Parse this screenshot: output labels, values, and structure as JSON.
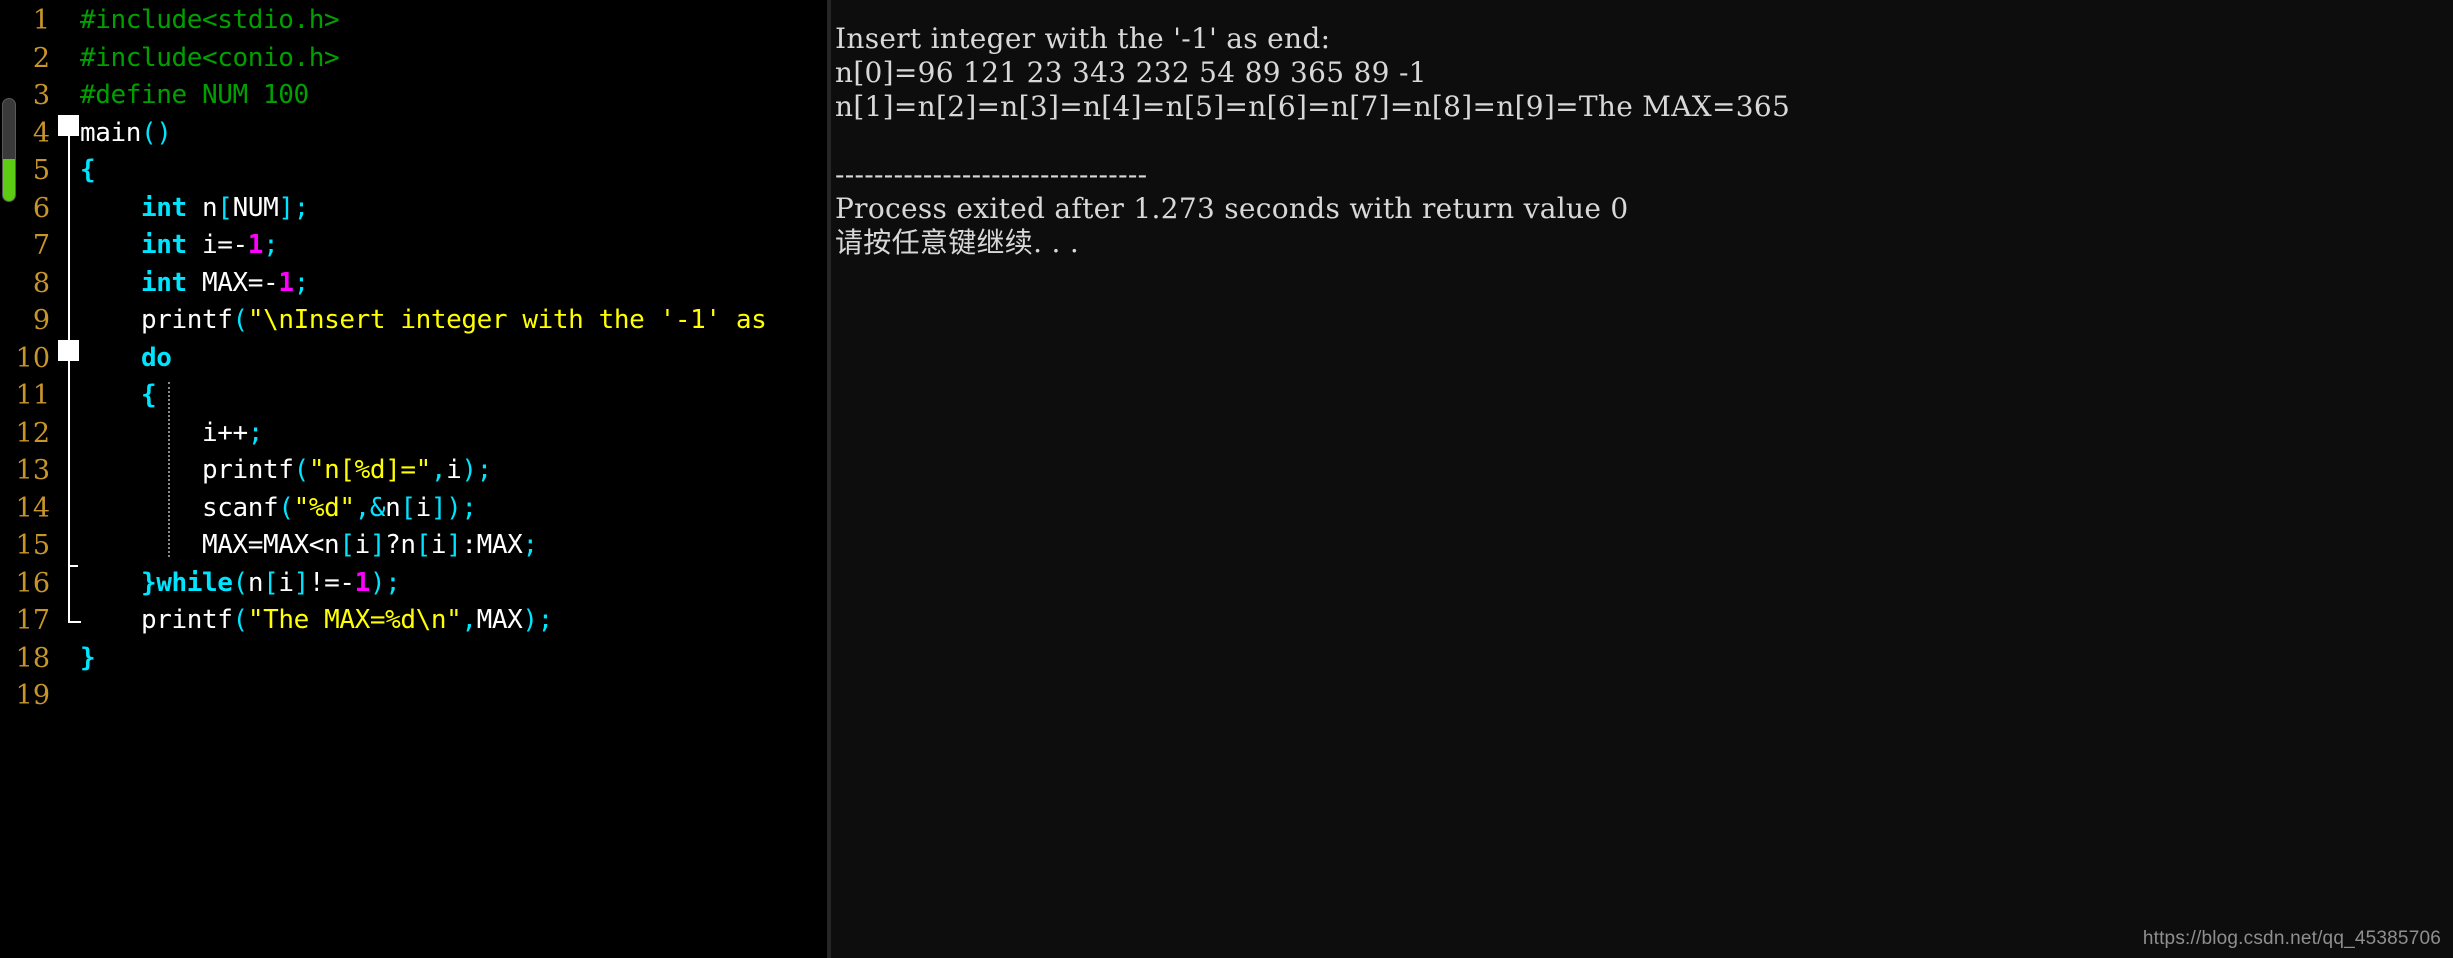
{
  "editor": {
    "name": "code-editor-pane",
    "language": "C",
    "background_color": "#000000",
    "line_numbers": [
      "1",
      "2",
      "3",
      "4",
      "5",
      "6",
      "7",
      "8",
      "9",
      "10",
      "11",
      "12",
      "13",
      "14",
      "15",
      "16",
      "17",
      "18",
      "19"
    ],
    "line_number_color": "#c8952b",
    "scrollbar": {
      "track_color": "#3a3a3a",
      "thumb_color": "#5ccc15"
    },
    "folded_lines": [
      "5",
      "11"
    ],
    "lines": [
      {
        "num": "1",
        "tokens": [
          {
            "t": "#include<stdio.h>",
            "c": "prep"
          }
        ]
      },
      {
        "num": "2",
        "tokens": [
          {
            "t": "#include<conio.h>",
            "c": "prep"
          }
        ]
      },
      {
        "num": "3",
        "tokens": [
          {
            "t": "#define NUM 100",
            "c": "prep"
          }
        ]
      },
      {
        "num": "4",
        "tokens": [
          {
            "t": "main",
            "c": "fn"
          },
          {
            "t": "()",
            "c": "punct"
          }
        ]
      },
      {
        "num": "5",
        "tokens": [
          {
            "t": "{",
            "c": "brace"
          }
        ]
      },
      {
        "num": "6",
        "tokens": [
          {
            "t": "    ",
            "c": "plain"
          },
          {
            "t": "int",
            "c": "kw"
          },
          {
            "t": " n",
            "c": "ident"
          },
          {
            "t": "[",
            "c": "punct"
          },
          {
            "t": "NUM",
            "c": "ident"
          },
          {
            "t": "]",
            "c": "punct"
          },
          {
            "t": ";",
            "c": "punct"
          }
        ]
      },
      {
        "num": "7",
        "tokens": [
          {
            "t": "    ",
            "c": "plain"
          },
          {
            "t": "int",
            "c": "kw"
          },
          {
            "t": " i=-",
            "c": "ident"
          },
          {
            "t": "1",
            "c": "num"
          },
          {
            "t": ";",
            "c": "punct"
          }
        ]
      },
      {
        "num": "8",
        "tokens": [
          {
            "t": "    ",
            "c": "plain"
          },
          {
            "t": "int",
            "c": "kw"
          },
          {
            "t": " MAX=-",
            "c": "ident"
          },
          {
            "t": "1",
            "c": "num"
          },
          {
            "t": ";",
            "c": "punct"
          }
        ]
      },
      {
        "num": "9",
        "tokens": [
          {
            "t": "    ",
            "c": "plain"
          },
          {
            "t": "printf",
            "c": "fn"
          },
          {
            "t": "(",
            "c": "punct"
          },
          {
            "t": "\"\\nInsert integer with the '-1' as",
            "c": "str"
          }
        ]
      },
      {
        "num": "10",
        "tokens": [
          {
            "t": "    ",
            "c": "plain"
          },
          {
            "t": "do",
            "c": "kw"
          }
        ]
      },
      {
        "num": "11",
        "tokens": [
          {
            "t": "    ",
            "c": "plain"
          },
          {
            "t": "{",
            "c": "brace"
          }
        ]
      },
      {
        "num": "12",
        "tokens": [
          {
            "t": "        ",
            "c": "plain"
          },
          {
            "t": "i++",
            "c": "ident"
          },
          {
            "t": ";",
            "c": "punct"
          }
        ]
      },
      {
        "num": "13",
        "tokens": [
          {
            "t": "        ",
            "c": "plain"
          },
          {
            "t": "printf",
            "c": "fn"
          },
          {
            "t": "(",
            "c": "punct"
          },
          {
            "t": "\"n[%d]=\"",
            "c": "str"
          },
          {
            "t": ",",
            "c": "punct"
          },
          {
            "t": "i",
            "c": "ident"
          },
          {
            "t": ");",
            "c": "punct"
          }
        ]
      },
      {
        "num": "14",
        "tokens": [
          {
            "t": "        ",
            "c": "plain"
          },
          {
            "t": "scanf",
            "c": "fn"
          },
          {
            "t": "(",
            "c": "punct"
          },
          {
            "t": "\"%d\"",
            "c": "str"
          },
          {
            "t": ",&",
            "c": "punct"
          },
          {
            "t": "n",
            "c": "ident"
          },
          {
            "t": "[",
            "c": "punct"
          },
          {
            "t": "i",
            "c": "ident"
          },
          {
            "t": "]",
            "c": "punct"
          },
          {
            "t": ");",
            "c": "punct"
          }
        ]
      },
      {
        "num": "15",
        "tokens": [
          {
            "t": "        ",
            "c": "plain"
          },
          {
            "t": "MAX=MAX<n",
            "c": "ident"
          },
          {
            "t": "[",
            "c": "punct"
          },
          {
            "t": "i",
            "c": "ident"
          },
          {
            "t": "]",
            "c": "punct"
          },
          {
            "t": "?n",
            "c": "ident"
          },
          {
            "t": "[",
            "c": "punct"
          },
          {
            "t": "i",
            "c": "ident"
          },
          {
            "t": "]",
            "c": "punct"
          },
          {
            "t": ":MAX",
            "c": "ident"
          },
          {
            "t": ";",
            "c": "punct"
          }
        ]
      },
      {
        "num": "16",
        "tokens": [
          {
            "t": "    ",
            "c": "plain"
          },
          {
            "t": "}",
            "c": "brace"
          },
          {
            "t": "while",
            "c": "kw"
          },
          {
            "t": "(",
            "c": "punct"
          },
          {
            "t": "n",
            "c": "ident"
          },
          {
            "t": "[",
            "c": "punct"
          },
          {
            "t": "i",
            "c": "ident"
          },
          {
            "t": "]",
            "c": "punct"
          },
          {
            "t": "!=-",
            "c": "ident"
          },
          {
            "t": "1",
            "c": "num"
          },
          {
            "t": ");",
            "c": "punct"
          }
        ]
      },
      {
        "num": "17",
        "tokens": [
          {
            "t": "    ",
            "c": "plain"
          },
          {
            "t": "printf",
            "c": "fn"
          },
          {
            "t": "(",
            "c": "punct"
          },
          {
            "t": "\"The MAX=%d\\n\"",
            "c": "str"
          },
          {
            "t": ",",
            "c": "punct"
          },
          {
            "t": "MAX",
            "c": "ident"
          },
          {
            "t": ");",
            "c": "punct"
          }
        ]
      },
      {
        "num": "18",
        "tokens": [
          {
            "t": "}",
            "c": "brace"
          }
        ]
      },
      {
        "num": "19",
        "tokens": []
      }
    ]
  },
  "console": {
    "name": "program-output-console",
    "background_color": "#0d0d0d",
    "text_color": "#d8d8d8",
    "lines": [
      "Insert integer with the '-1' as end:",
      "n[0]=96 121 23 343 232 54 89 365 89 -1",
      "n[1]=n[2]=n[3]=n[4]=n[5]=n[6]=n[7]=n[8]=n[9]=The MAX=365",
      "",
      "--------------------------------",
      "Process exited after 1.273 seconds with return value 0",
      "请按任意键继续. . ."
    ]
  },
  "watermark": {
    "text": "https://blog.csdn.net/qq_45385706"
  }
}
